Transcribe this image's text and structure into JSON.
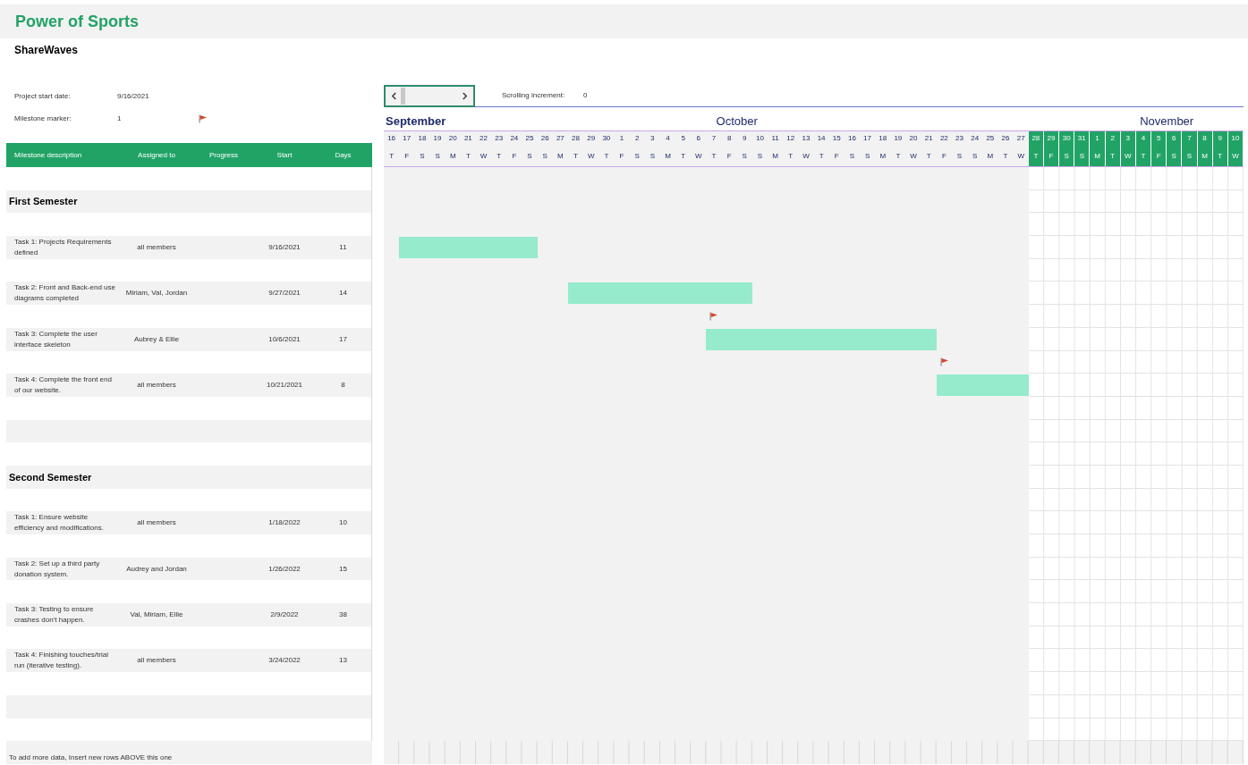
{
  "title": "Power of Sports",
  "subtitle": "ShareWaves",
  "settings": [
    {
      "kind": "date",
      "label": "Project start date:",
      "value": "9/16/2021"
    },
    {
      "kind": "marker",
      "label": "Milestone marker:",
      "value": "1"
    }
  ],
  "scroller": {
    "label": "Scrolling increment:",
    "value": "0"
  },
  "months": [
    {
      "label": "September"
    },
    {
      "label": "October"
    },
    {
      "label": "November"
    }
  ],
  "days": [
    {
      "day": "16",
      "weekday": "T",
      "highlight": false
    },
    {
      "day": "17",
      "weekday": "F",
      "highlight": false
    },
    {
      "day": "18",
      "weekday": "S",
      "highlight": false
    },
    {
      "day": "19",
      "weekday": "S",
      "highlight": false
    },
    {
      "day": "20",
      "weekday": "M",
      "highlight": false
    },
    {
      "day": "21",
      "weekday": "T",
      "highlight": false
    },
    {
      "day": "22",
      "weekday": "W",
      "highlight": false
    },
    {
      "day": "23",
      "weekday": "T",
      "highlight": false
    },
    {
      "day": "24",
      "weekday": "F",
      "highlight": false
    },
    {
      "day": "25",
      "weekday": "S",
      "highlight": false
    },
    {
      "day": "26",
      "weekday": "S",
      "highlight": false
    },
    {
      "day": "27",
      "weekday": "M",
      "highlight": false
    },
    {
      "day": "28",
      "weekday": "T",
      "highlight": false
    },
    {
      "day": "29",
      "weekday": "W",
      "highlight": false
    },
    {
      "day": "30",
      "weekday": "T",
      "highlight": false
    },
    {
      "day": "1",
      "weekday": "F",
      "highlight": false
    },
    {
      "day": "2",
      "weekday": "S",
      "highlight": false
    },
    {
      "day": "3",
      "weekday": "S",
      "highlight": false
    },
    {
      "day": "4",
      "weekday": "M",
      "highlight": false
    },
    {
      "day": "5",
      "weekday": "T",
      "highlight": false
    },
    {
      "day": "6",
      "weekday": "W",
      "highlight": false
    },
    {
      "day": "7",
      "weekday": "T",
      "highlight": false
    },
    {
      "day": "8",
      "weekday": "F",
      "highlight": false
    },
    {
      "day": "9",
      "weekday": "S",
      "highlight": false
    },
    {
      "day": "10",
      "weekday": "S",
      "highlight": false
    },
    {
      "day": "11",
      "weekday": "M",
      "highlight": false
    },
    {
      "day": "12",
      "weekday": "T",
      "highlight": false
    },
    {
      "day": "13",
      "weekday": "W",
      "highlight": false
    },
    {
      "day": "14",
      "weekday": "T",
      "highlight": false
    },
    {
      "day": "15",
      "weekday": "F",
      "highlight": false
    },
    {
      "day": "16",
      "weekday": "S",
      "highlight": false
    },
    {
      "day": "17",
      "weekday": "S",
      "highlight": false
    },
    {
      "day": "18",
      "weekday": "M",
      "highlight": false
    },
    {
      "day": "19",
      "weekday": "T",
      "highlight": false
    },
    {
      "day": "20",
      "weekday": "W",
      "highlight": false
    },
    {
      "day": "21",
      "weekday": "T",
      "highlight": false
    },
    {
      "day": "22",
      "weekday": "F",
      "highlight": false
    },
    {
      "day": "23",
      "weekday": "S",
      "highlight": false
    },
    {
      "day": "24",
      "weekday": "S",
      "highlight": false
    },
    {
      "day": "25",
      "weekday": "M",
      "highlight": false
    },
    {
      "day": "26",
      "weekday": "T",
      "highlight": false
    },
    {
      "day": "27",
      "weekday": "W",
      "highlight": false
    },
    {
      "day": "28",
      "weekday": "T",
      "highlight": true
    },
    {
      "day": "29",
      "weekday": "F",
      "highlight": true
    },
    {
      "day": "30",
      "weekday": "S",
      "highlight": true
    },
    {
      "day": "31",
      "weekday": "S",
      "highlight": true
    },
    {
      "day": "1",
      "weekday": "M",
      "highlight": true
    },
    {
      "day": "2",
      "weekday": "T",
      "highlight": true
    },
    {
      "day": "3",
      "weekday": "W",
      "highlight": true
    },
    {
      "day": "4",
      "weekday": "T",
      "highlight": true
    },
    {
      "day": "5",
      "weekday": "F",
      "highlight": true
    },
    {
      "day": "6",
      "weekday": "S",
      "highlight": true
    },
    {
      "day": "7",
      "weekday": "S",
      "highlight": true
    },
    {
      "day": "8",
      "weekday": "M",
      "highlight": true
    },
    {
      "day": "9",
      "weekday": "T",
      "highlight": true
    },
    {
      "day": "10",
      "weekday": "W",
      "highlight": true
    }
  ],
  "columns": [
    "Milestone description",
    "Assigned to",
    "Progress",
    "Start",
    "Days"
  ],
  "sections": [
    {
      "title": "First Semester",
      "tasks": [
        {
          "description": "Task 1: Projects Requirements defined",
          "assigned": "all members",
          "start": "9/16/2021",
          "days": "11",
          "milestone": false
        },
        {
          "description": "Task 2: Front and Back-end use diagrams completed",
          "assigned": "Miriam, Val, Jordan",
          "start": "9/27/2021",
          "days": "14",
          "milestone": false
        },
        {
          "description": "Task 3: Complete the user interface skeleton",
          "assigned": "Aubrey & Ellie",
          "start": "10/6/2021",
          "days": "17",
          "milestone": true
        },
        {
          "description": "Task 4: Complete the front end of our website.",
          "assigned": "all members",
          "start": "10/21/2021",
          "days": "8",
          "milestone": true
        }
      ]
    },
    {
      "title": "Second Semester",
      "tasks": [
        {
          "description": "Task 1: Ensure website efficiency and modifications.",
          "assigned": "all members",
          "start": "1/18/2022",
          "days": "10",
          "milestone": false
        },
        {
          "description": "Task 2: Set up a third party donation system.",
          "assigned": "Audrey and Jordan",
          "start": "1/26/2022",
          "days": "15",
          "milestone": false
        },
        {
          "description": "Task 3: Testing to ensure crashes don’t happen.",
          "assigned": "Val, Miriam, Ellie",
          "start": "2/9/2022",
          "days": "38",
          "milestone": false
        },
        {
          "description": "Task 4: Finishing touches/trial run (iterative testing).",
          "assigned": "all members",
          "start": "3/24/2022",
          "days": "13",
          "milestone": false
        }
      ]
    }
  ],
  "footer": "To add more data, Insert new rows ABOVE this one"
}
